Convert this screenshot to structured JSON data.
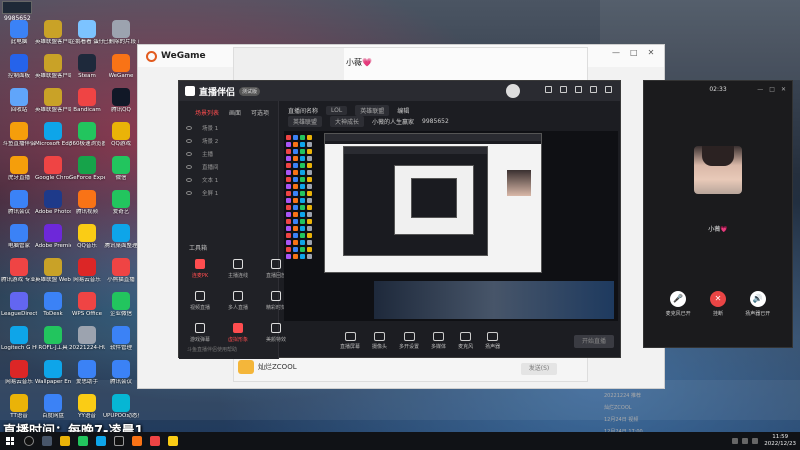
{
  "desktop": {
    "top_badge": "9985652",
    "icons": [
      {
        "label": "此电脑",
        "color": "#3b82f6"
      },
      {
        "label": "英雄联盟客户端 bgm",
        "color": "#c9a227"
      },
      {
        "label": "企鹅看看 蛋仔",
        "color": "#7cc3ff"
      },
      {
        "label": "已删除的片段 已删除",
        "color": "#9ca3af"
      },
      {
        "label": "控制面板",
        "color": "#2563eb"
      },
      {
        "label": "英雄联盟客户端",
        "color": "#c9a227"
      },
      {
        "label": "Steam",
        "color": "#1e293b"
      },
      {
        "label": "WeGame",
        "color": "#f97316"
      },
      {
        "label": "回收站",
        "color": "#60a5fa"
      },
      {
        "label": "英雄联盟客户端 bgm",
        "color": "#c9a227"
      },
      {
        "label": "Bandicam",
        "color": "#ef4444"
      },
      {
        "label": "腾讯QQ",
        "color": "#111827"
      },
      {
        "label": "斗鱼直播伴侣",
        "color": "#f59e0b"
      },
      {
        "label": "Microsoft Edge",
        "color": "#0ea5e9"
      },
      {
        "label": "360极速浏览器",
        "color": "#22c55e"
      },
      {
        "label": "QQ游戏",
        "color": "#eab308"
      },
      {
        "label": "虎牙直播",
        "color": "#f59e0b"
      },
      {
        "label": "Google Chrome",
        "color": "#ef4444"
      },
      {
        "label": "GeForce Experience",
        "color": "#16a34a"
      },
      {
        "label": "微信",
        "color": "#22c55e"
      },
      {
        "label": "腾讯会议",
        "color": "#3b82f6"
      },
      {
        "label": "Adobe Photosh...",
        "color": "#1e3a8a"
      },
      {
        "label": "腾讯视频",
        "color": "#f97316"
      },
      {
        "label": "爱奇艺",
        "color": "#22c55e"
      },
      {
        "label": "电脑管家",
        "color": "#3b82f6"
      },
      {
        "label": "Adobe Premie...",
        "color": "#6d28d9"
      },
      {
        "label": "QQ音乐",
        "color": "#facc15"
      },
      {
        "label": "腾讯桌面整理",
        "color": "#0ea5e9"
      },
      {
        "label": "腾讯游戏 专业版",
        "color": "#ef4444"
      },
      {
        "label": "英雄联盟 Web",
        "color": "#c9a227"
      },
      {
        "label": "网易云音乐",
        "color": "#dc2626"
      },
      {
        "label": "小熊猫直播",
        "color": "#ef4444"
      },
      {
        "label": "LeagueDirector",
        "color": "#6366f1"
      },
      {
        "label": "ToDesk",
        "color": "#3b82f6"
      },
      {
        "label": "WPS Office",
        "color": "#ef4444"
      },
      {
        "label": "企业微信",
        "color": "#22c55e"
      },
      {
        "label": "Logitech G HUB",
        "color": "#0ea5e9"
      },
      {
        "label": "ROFL-J工具",
        "color": "#22c55e"
      },
      {
        "label": "20221224-HUB",
        "color": "#9ca3af"
      },
      {
        "label": "软件管理",
        "color": "#3b82f6"
      },
      {
        "label": "网易云音乐",
        "color": "#dc2626"
      },
      {
        "label": "Wallpaper Engine",
        "color": "#0ea5e9"
      },
      {
        "label": "爱思助手",
        "color": "#3b82f6"
      },
      {
        "label": "腾讯会议",
        "color": "#3b82f6"
      },
      {
        "label": "TT语音",
        "color": "#eab308"
      },
      {
        "label": "百度网盘",
        "color": "#3b82f6"
      },
      {
        "label": "YY语音",
        "color": "#facc15"
      },
      {
        "label": "UPUPOO动态桌面",
        "color": "#06b6d4"
      }
    ]
  },
  "wegame": {
    "title": "WeGame",
    "controls": [
      "—",
      "□",
      "✕"
    ]
  },
  "chat": {
    "contact_name": "小薇💗",
    "bottom_label": "灿烂ZCOOL",
    "send_label": "发送(S)"
  },
  "live_companion": {
    "title": "直播伴侣",
    "version_badge": "测试版",
    "tabs": [
      "场景列表",
      "画面",
      "可选项"
    ],
    "scenes": [
      "场景 1",
      "场景 2",
      "主播",
      "直播间",
      "文本 1",
      "全屏 1"
    ],
    "tools_label": "工具箱",
    "tools": [
      {
        "label": "连麦PK",
        "red": true
      },
      {
        "label": "主播连线",
        "red": false
      },
      {
        "label": "直播回放",
        "red": false
      },
      {
        "label": "视频直播",
        "red": false
      },
      {
        "label": "多人直播",
        "red": false
      },
      {
        "label": "精彩时刻",
        "red": false
      },
      {
        "label": "游戏弹幕",
        "red": false
      },
      {
        "label": "虚拟形象",
        "red": true
      },
      {
        "label": "美颜特效",
        "red": false
      }
    ],
    "footer": "斗鱼直播伴侣使用帮助",
    "toolbar_row1": [
      "直播间名称",
      "LOL",
      "英雄联盟",
      "编辑"
    ],
    "toolbar_row2": [
      "英雄联盟",
      "大神成长",
      "小薇的人生赢家",
      "9985652"
    ],
    "controls": [
      "直播屏幕",
      "摄像头",
      "多开设置",
      "多媒体",
      "麦克风",
      "扬声器"
    ],
    "start_label": "开始直播"
  },
  "call": {
    "time": "02:33",
    "name": "小薇💗",
    "controls": [
      "—",
      "□",
      "✕"
    ],
    "buttons": [
      {
        "label": "麦克风已开",
        "icon": "🎤"
      },
      {
        "label": "挂断",
        "icon": "✕"
      },
      {
        "label": "扬声器已开",
        "icon": "🔊"
      }
    ]
  },
  "right_panel": {
    "rows": [
      "20221224 推荐",
      "灿烂ZCOOL",
      "12月24日 视频",
      "12月24日 17:00"
    ]
  },
  "caption": "直播时间：每晚7-凌晨1",
  "taskbar": {
    "time": "11:59",
    "date": "2022/12/23"
  }
}
